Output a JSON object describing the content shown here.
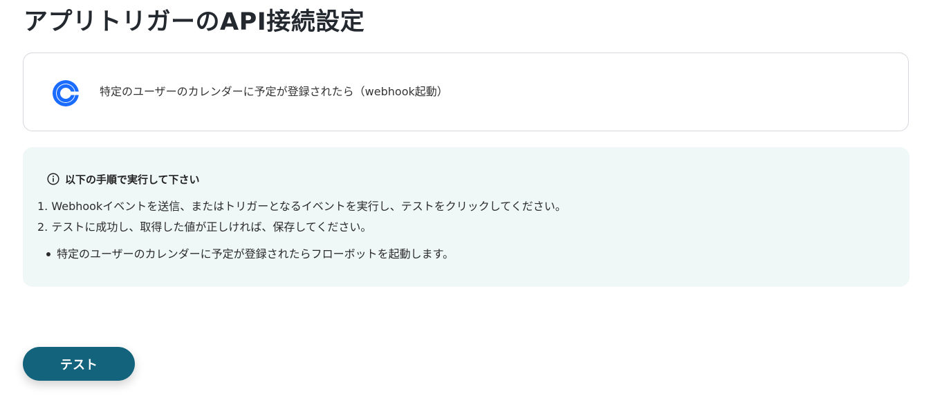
{
  "page": {
    "title": "アプリトリガーのAPI接続設定"
  },
  "trigger": {
    "label": "特定のユーザーのカレンダーに予定が登録されたら（webhook起動）",
    "icon": "calendly-icon",
    "icon_color": "#1a6bff"
  },
  "instructions": {
    "heading": "以下の手順で実行して下さい",
    "icon": "info-icon",
    "steps": [
      "1. Webhookイベントを送信、またはトリガーとなるイベントを実行し、テストをクリックしてください。",
      "2. テストに成功し、取得した値が正しければ、保存してください。"
    ],
    "notes": [
      "特定のユーザーのカレンダーに予定が登録されたらフローボットを起動します。"
    ],
    "background": "#eff7f7"
  },
  "actions": {
    "test_label": "テスト",
    "test_color": "#13637c"
  }
}
